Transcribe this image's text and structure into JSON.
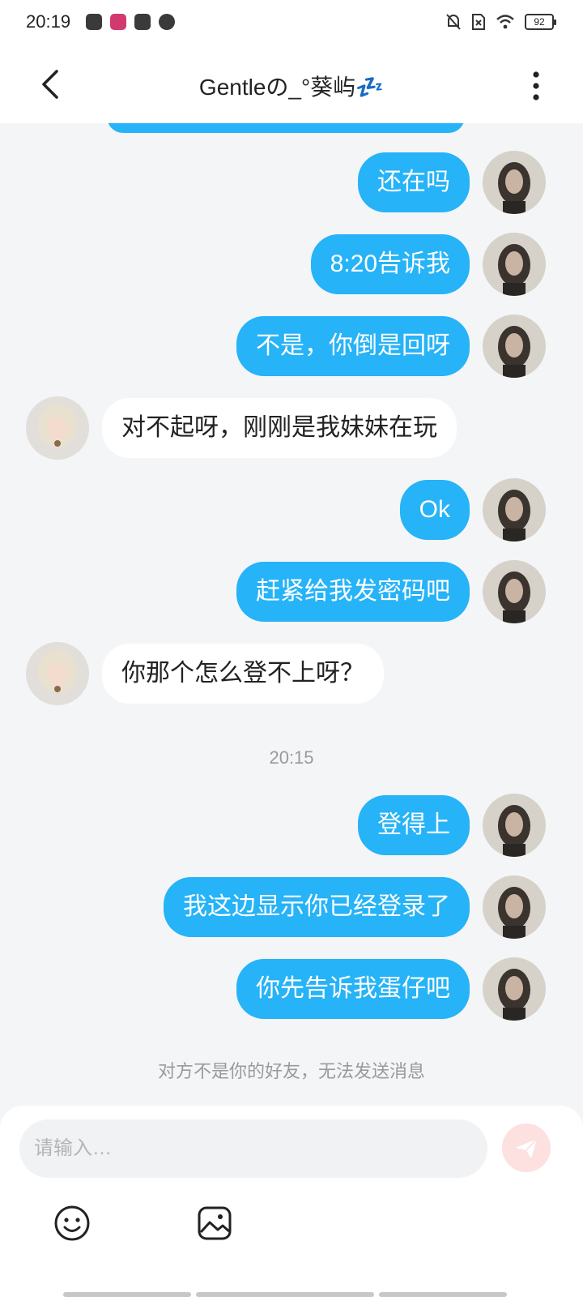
{
  "status_bar": {
    "time": "20:19",
    "battery": "92",
    "left_icons": [
      "app-icon",
      "app-icon",
      "mail-icon",
      "speed-icon"
    ],
    "right_icons": [
      "mute-bell-icon",
      "no-sim-icon",
      "wifi-icon",
      "battery-icon"
    ]
  },
  "header": {
    "title": "Gentleの_°葵屿💤",
    "back_icon": "chevron-left-icon",
    "more_icon": "more-vertical-icon"
  },
  "messages": [
    {
      "sender": "me",
      "text": "还在吗"
    },
    {
      "sender": "me",
      "text": "8:20告诉我"
    },
    {
      "sender": "me",
      "text": "不是，你倒是回呀"
    },
    {
      "sender": "other",
      "text": "对不起呀，刚刚是我妹妹在玩"
    },
    {
      "sender": "me",
      "text": "Ok"
    },
    {
      "sender": "me",
      "text": "赶紧给我发密码吧"
    },
    {
      "sender": "other",
      "text": "你那个怎么登不上呀？"
    },
    {
      "sender": "me",
      "text": "登得上"
    },
    {
      "sender": "me",
      "text": "我这边显示你已经登录了"
    },
    {
      "sender": "me",
      "text": "你先告诉我蛋仔吧"
    }
  ],
  "timestamp": "20:15",
  "notice": "对方不是你的好友，无法发送消息",
  "composer": {
    "placeholder": "请输入…",
    "send_icon": "send-icon",
    "emoji_icon": "emoji-icon",
    "image_icon": "image-icon"
  },
  "colors": {
    "my_bubble": "#26b3f7",
    "other_bubble": "#ffffff",
    "background": "#f4f5f7",
    "send_button": "#fde0e0",
    "send_icon": "#ffffff"
  }
}
